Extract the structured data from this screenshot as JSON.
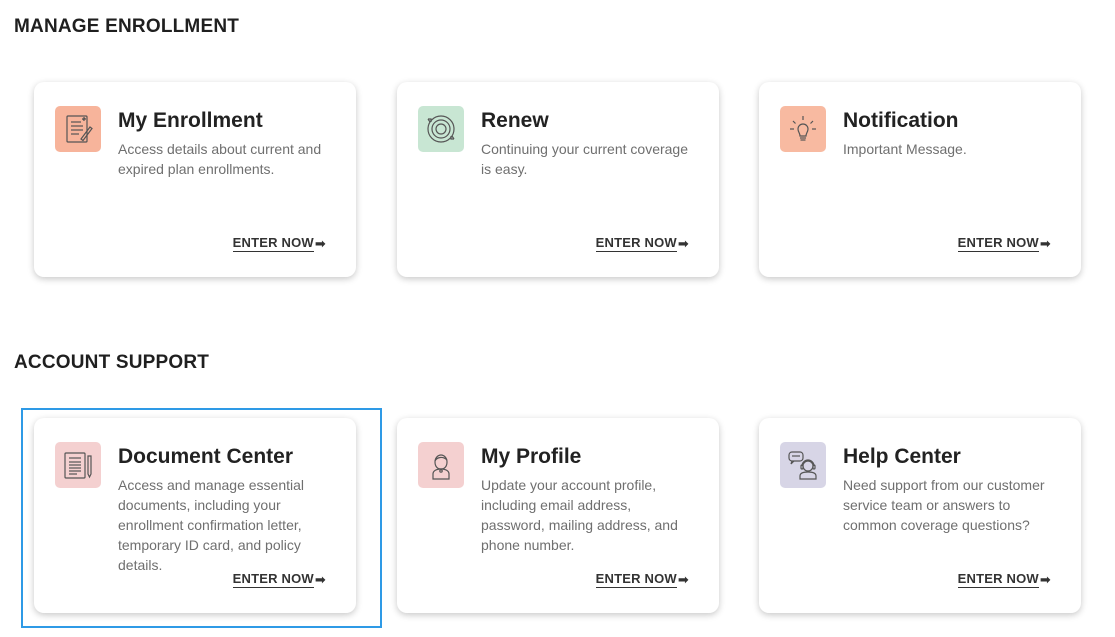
{
  "sections": [
    {
      "title": "MANAGE ENROLLMENT",
      "cards": [
        {
          "title": "My Enrollment",
          "desc": "Access details about current and expired plan enrollments.",
          "cta": "ENTER NOW",
          "icon": "enrollment-form-icon",
          "icon_bg": "#f7b49b"
        },
        {
          "title": "Renew",
          "desc": "Continuing your current coverage is easy.",
          "cta": "ENTER NOW",
          "icon": "renew-cycle-icon",
          "icon_bg": "#c8e6d3"
        },
        {
          "title": "Notification",
          "desc": "Important Message.",
          "cta": "ENTER NOW",
          "icon": "lightbulb-icon",
          "icon_bg": "#f8baa1"
        }
      ]
    },
    {
      "title": "ACCOUNT SUPPORT",
      "cards": [
        {
          "title": "Document Center",
          "desc": "Access and manage essential documents, including your enrollment confirmation letter, temporary ID card, and policy details.",
          "cta": "ENTER NOW",
          "icon": "document-pencil-icon",
          "icon_bg": "#f4d0d0"
        },
        {
          "title": "My Profile",
          "desc": "Update your account profile, including email address, password, mailing address, and phone number.",
          "cta": "ENTER NOW",
          "icon": "user-profile-icon",
          "icon_bg": "#f4d0d0"
        },
        {
          "title": "Help Center",
          "desc": "Need support from our customer service team or answers to common coverage questions?",
          "cta": "ENTER NOW",
          "icon": "support-agent-icon",
          "icon_bg": "#d7d5e6"
        }
      ]
    }
  ],
  "arrow_glyph": "➡",
  "selection_color": "#2e9ae6"
}
